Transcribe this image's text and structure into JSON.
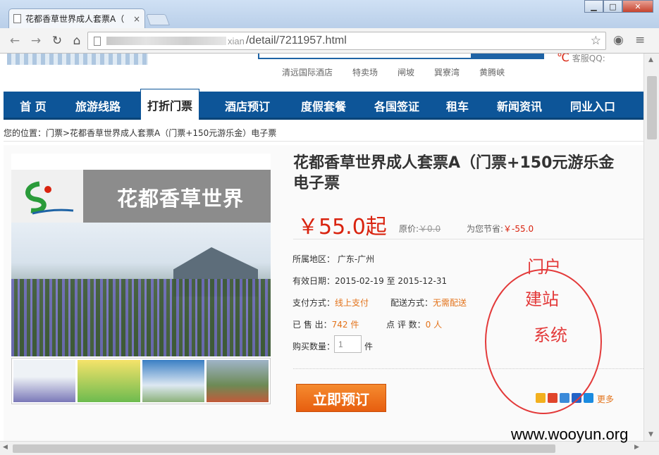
{
  "browser": {
    "tab_title": "花都香草世界成人套票A（",
    "tab_close": "×",
    "url_visible": "/detail/7211957.html",
    "url_fragment": "xian"
  },
  "header": {
    "qq_label": "客服QQ:",
    "hot_places": [
      "清远国际酒店",
      "特卖场",
      "闸坡",
      "巽寮湾",
      "黄腾峡"
    ]
  },
  "nav": {
    "items": [
      {
        "label": "首 页"
      },
      {
        "label": "旅游线路"
      },
      {
        "label": "打折门票",
        "active": true
      },
      {
        "label": "酒店预订"
      },
      {
        "label": "度假套餐"
      },
      {
        "label": "各国签证"
      },
      {
        "label": "租车"
      },
      {
        "label": "新闻资讯"
      },
      {
        "label": "同业入口"
      }
    ]
  },
  "breadcrumb": {
    "text": "您的位置：门票>花都香草世界成人套票A（门票+150元游乐金）电子票"
  },
  "product": {
    "banner_text": "花都香草世界",
    "title_line1": "花都香草世界成人套票A（门票+150元游乐金",
    "title_line2": "电子票",
    "price": "￥55.0起",
    "orig_label": "原价:",
    "orig_value": "￥0.0",
    "save_label": "为您节省:",
    "save_value": "￥-55.0",
    "region_label": "所属地区：",
    "region_value": "广东-广州",
    "valid_label": "有效日期：",
    "valid_value": "2015-02-19 至 2015-12-31",
    "pay_label": "支付方式：",
    "pay_value": "线上支付",
    "delivery_label": "配送方式：",
    "delivery_value": "无需配送",
    "sold_label": "已 售 出：",
    "sold_value": "742 件",
    "reviews_label": "点 评 数：",
    "reviews_value": "0 人",
    "qty_label": "购买数量：",
    "qty_value": "1",
    "qty_unit": "件",
    "book_button": "立即预订",
    "share_more": "更多"
  },
  "annotation": {
    "line1": "门户",
    "line2": "建站",
    "line3": "系统"
  },
  "watermark": "www.wooyun.org",
  "colors": {
    "nav_blue": "#0d5598",
    "price_red": "#d9230f",
    "accent_orange": "#e3731b",
    "book_orange": "#f08227",
    "annot_red": "#e33a3a"
  }
}
